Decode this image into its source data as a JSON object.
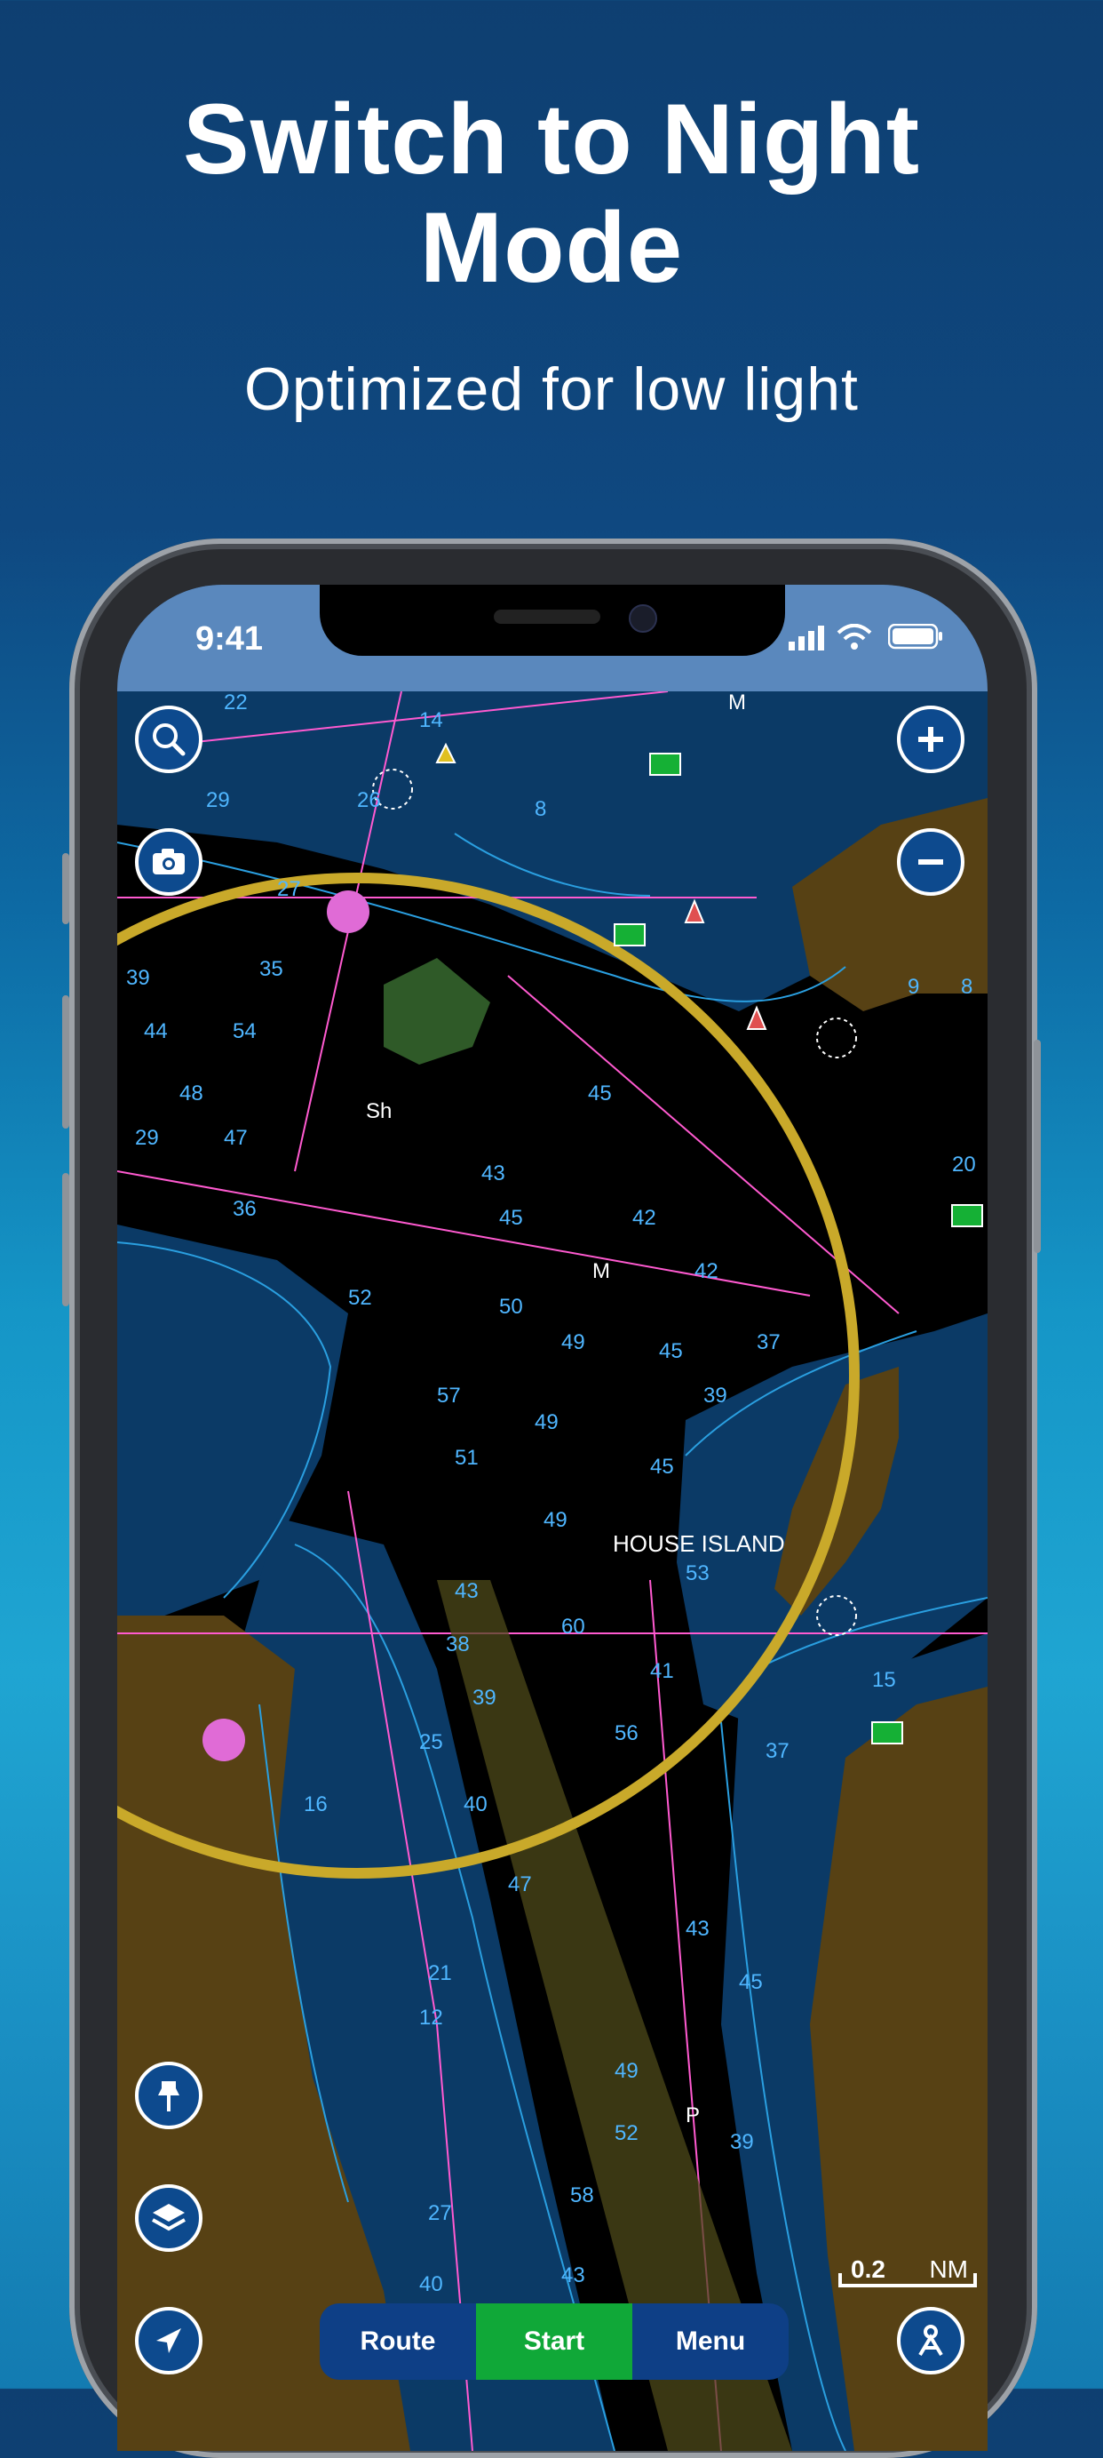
{
  "headline": {
    "line1": "Switch to Night",
    "line2": "Mode",
    "subtitle": "Optimized for low light"
  },
  "status_bar": {
    "time": "9:41"
  },
  "map": {
    "place_label": "HOUSE ISLAND",
    "depths": [
      "22",
      "29",
      "26",
      "27",
      "8",
      "14",
      "39",
      "44",
      "54",
      "48",
      "29",
      "47",
      "36",
      "35",
      "45",
      "43",
      "42",
      "45",
      "52",
      "50",
      "49",
      "45",
      "37",
      "57",
      "51",
      "49",
      "42",
      "39",
      "45",
      "49",
      "53",
      "60",
      "43",
      "41",
      "38",
      "56",
      "39",
      "25",
      "40",
      "37",
      "16",
      "15",
      "47",
      "21",
      "12",
      "43",
      "45",
      "49",
      "52",
      "39",
      "58",
      "43",
      "27",
      "40",
      "9",
      "8",
      "20"
    ],
    "markers": [
      "M",
      "Sh",
      "M",
      "P"
    ],
    "scale_value": "0.2",
    "scale_unit": "NM"
  },
  "controls": {
    "search_icon": "search-icon",
    "camera_icon": "camera-icon",
    "zoom_in_icon": "plus-icon",
    "zoom_out_icon": "minus-icon",
    "pin_icon": "pin-icon",
    "layers_icon": "layers-icon",
    "locate_icon": "navigation-arrow-icon",
    "person_icon": "person-icon"
  },
  "bottom_bar": {
    "route": "Route",
    "start": "Start",
    "menu": "Menu"
  },
  "colors": {
    "land": "#574114",
    "shallow": "#0b3a66",
    "deep": "#000000",
    "contour": "#2a9fe0",
    "route_line": "#ff5ad0",
    "range_ring_outer": "#c9a92a",
    "range_ring_inner": "#c94a48",
    "button_blue": "#0d4a8e",
    "start_green": "#10a838"
  }
}
